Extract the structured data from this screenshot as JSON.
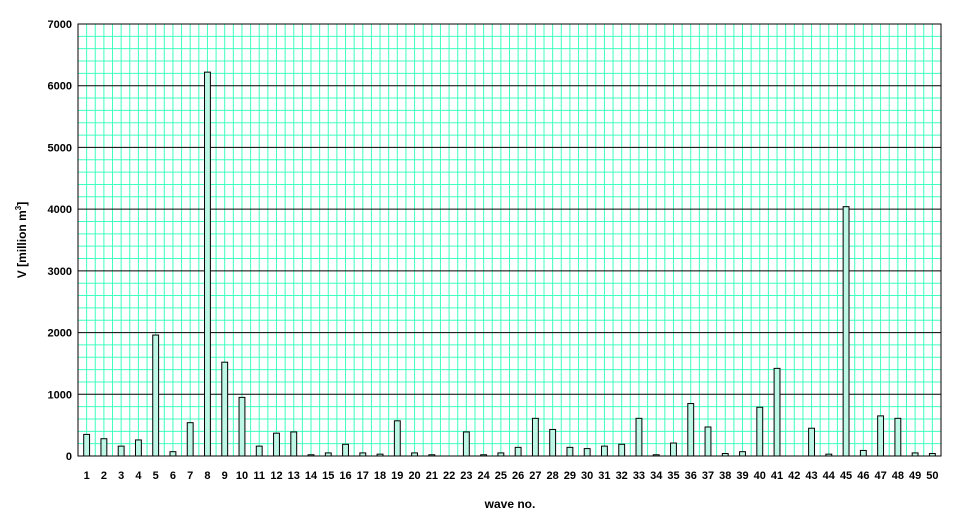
{
  "colors": {
    "plot_background": "#ffffff",
    "grid_minor": "#40ffbf",
    "grid_major": "#000000",
    "bar_fill": "#bff7e6",
    "bar_stroke": "#000000"
  },
  "chart_data": {
    "type": "bar",
    "title": "",
    "xlabel": "wave no.",
    "ylabel_main": "V [million m",
    "ylabel_sup": "3",
    "ylabel_end": "]",
    "ylim": [
      0,
      7000
    ],
    "yticks": [
      "0",
      "1000",
      "2000",
      "3000",
      "4000",
      "5000",
      "6000",
      "7000"
    ],
    "grid": true,
    "categories": [
      "1",
      "2",
      "3",
      "4",
      "5",
      "6",
      "7",
      "8",
      "9",
      "10",
      "11",
      "12",
      "13",
      "14",
      "15",
      "16",
      "17",
      "18",
      "19",
      "20",
      "21",
      "22",
      "23",
      "24",
      "25",
      "26",
      "27",
      "28",
      "29",
      "30",
      "31",
      "32",
      "33",
      "34",
      "35",
      "36",
      "37",
      "38",
      "39",
      "40",
      "41",
      "42",
      "43",
      "44",
      "45",
      "46",
      "47",
      "48",
      "49",
      "50"
    ],
    "values": [
      350,
      280,
      160,
      260,
      1960,
      70,
      540,
      6220,
      1520,
      950,
      160,
      370,
      390,
      20,
      50,
      190,
      50,
      30,
      570,
      50,
      20,
      0,
      390,
      20,
      50,
      140,
      610,
      430,
      140,
      120,
      160,
      190,
      610,
      20,
      210,
      850,
      470,
      40,
      70,
      790,
      1420,
      0,
      450,
      30,
      4040,
      90,
      650,
      610,
      50,
      40
    ]
  }
}
